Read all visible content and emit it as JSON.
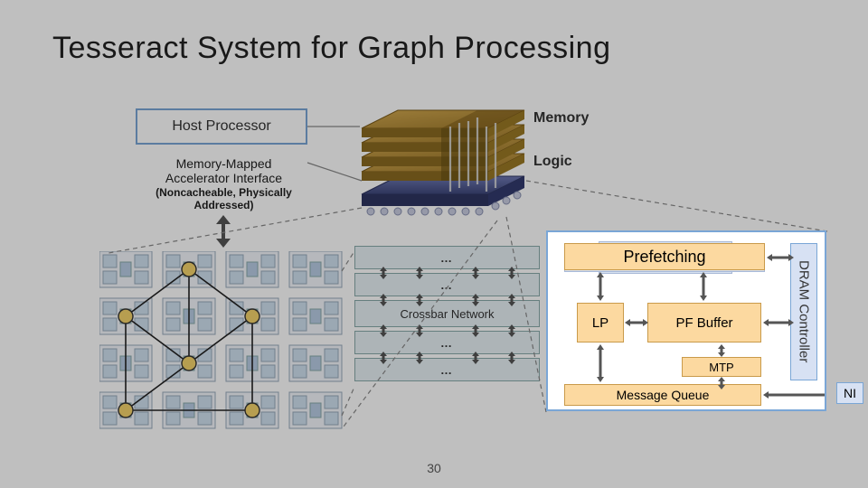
{
  "title": "Tesseract System for Graph Processing",
  "host_processor": "Host Processor",
  "mmap_line1": "Memory-Mapped",
  "mmap_line2": "Accelerator Interface",
  "mmap_note": "(Noncacheable, Physically Addressed)",
  "memory_label": "Memory",
  "logic_label": "Logic",
  "crossbar_label": "Crossbar Network",
  "dots": "…",
  "panel": {
    "prefetching": "Prefetching",
    "lp": "LP",
    "pf": "PF Buffer",
    "mtp": "MTP",
    "mq": "Message Queue",
    "dram": "DRAM Controller",
    "ni": "NI"
  },
  "page_number": "30",
  "colors": {
    "accent": "#fcd9a0",
    "accent_border": "#c99a4a",
    "blue": "#7aa6d6",
    "bluefill": "#d7e1f3",
    "slice": "#e7f0f5"
  }
}
